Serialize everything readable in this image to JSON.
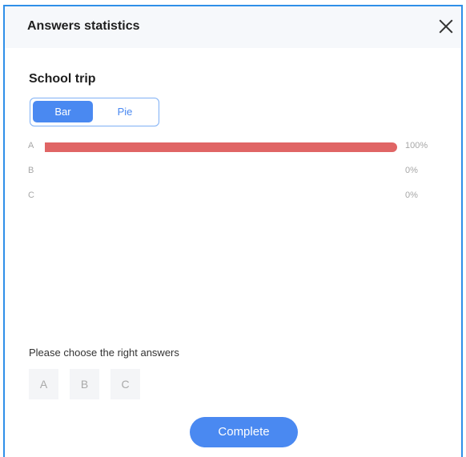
{
  "dialog": {
    "title": "Answers statistics",
    "close_icon": "close-icon"
  },
  "question": {
    "title": "School trip"
  },
  "view_toggle": {
    "options": [
      "Bar",
      "Pie"
    ],
    "selected": "Bar"
  },
  "chart_data": {
    "type": "bar",
    "categories": [
      "A",
      "B",
      "C"
    ],
    "values": [
      100,
      0,
      0
    ],
    "value_labels": [
      "100%",
      "0%",
      "0%"
    ],
    "bar_color": "#e06565",
    "orientation": "horizontal"
  },
  "answer_prompt": "Please choose the right answers",
  "answer_options": [
    "A",
    "B",
    "C"
  ],
  "complete_label": "Complete",
  "colors": {
    "accent": "#4a89f1",
    "frame": "#2f8fe8"
  }
}
